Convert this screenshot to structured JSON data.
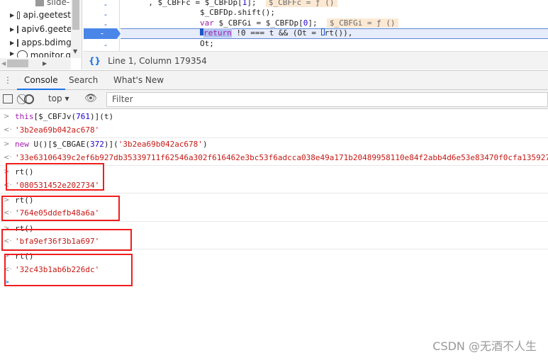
{
  "file_tree": {
    "items": [
      {
        "label": "slide-"
      },
      {
        "label": "api.geetest"
      },
      {
        "label": "apiv6.geetest"
      },
      {
        "label": "apps.bdimg"
      },
      {
        "label": "monitor.g"
      }
    ]
  },
  "editor": {
    "code_lines": [
      {
        "marker": "-",
        "pre": "  , $_CBFFc = $_CBFDp[",
        "n": "1",
        "post": "];",
        "inline": "$_CBFFc = ƒ ()"
      },
      {
        "marker": "-",
        "text": "$_CBFDp.shift();"
      },
      {
        "marker": "-",
        "kw": "var",
        "pre": " $_CBFGi = $_CBFDp[",
        "n": "0",
        "post": "];",
        "inline": "$_CBFGi = ƒ ()"
      },
      {
        "marker": "-",
        "kw": "return",
        "rest": " !0 === t && (Ot = ",
        "rest2": "rt()),"
      },
      {
        "marker": "-",
        "text": "Ot;"
      }
    ],
    "status": "Line 1, Column 179354"
  },
  "drawer_tabs": [
    {
      "label": "Console",
      "active": true
    },
    {
      "label": "Search"
    },
    {
      "label": "What's New"
    }
  ],
  "toolbar": {
    "context": "top",
    "filter_placeholder": "Filter"
  },
  "console": {
    "entries": [
      {
        "input": {
          "a": "this",
          "b": "[$_CBFJv(",
          "n": "761",
          "c": ")](t)"
        },
        "result": "'3b2ea69b042ac678'"
      },
      {
        "input": {
          "a": "new",
          "b": " U()[$_CBGAE(",
          "n": "372",
          "c": ")](",
          "s": "'3b2ea69b042ac678'",
          "d": ")"
        },
        "result": "'33e63106439c2ef6b927db35339711f62546a302f616462e3bc53f6adcca038e49a171b20489958110e84f2abb4d6e53e83470f0cfa135927"
      },
      {
        "input": {
          "b": "rt()"
        },
        "result": "'080531452e202734'"
      },
      {
        "input": {
          "b": "rt()"
        },
        "result": "'764e05ddefb48a6a'"
      },
      {
        "input": {
          "b": "rt()"
        },
        "result": "'bfa9ef36f3b1a697'"
      },
      {
        "input": {
          "b": "rt()"
        },
        "result": "'32c43b1ab6b226dc'"
      }
    ]
  },
  "highlight_color": "#f21d1d",
  "watermark": "CSDN @无酒不人生"
}
